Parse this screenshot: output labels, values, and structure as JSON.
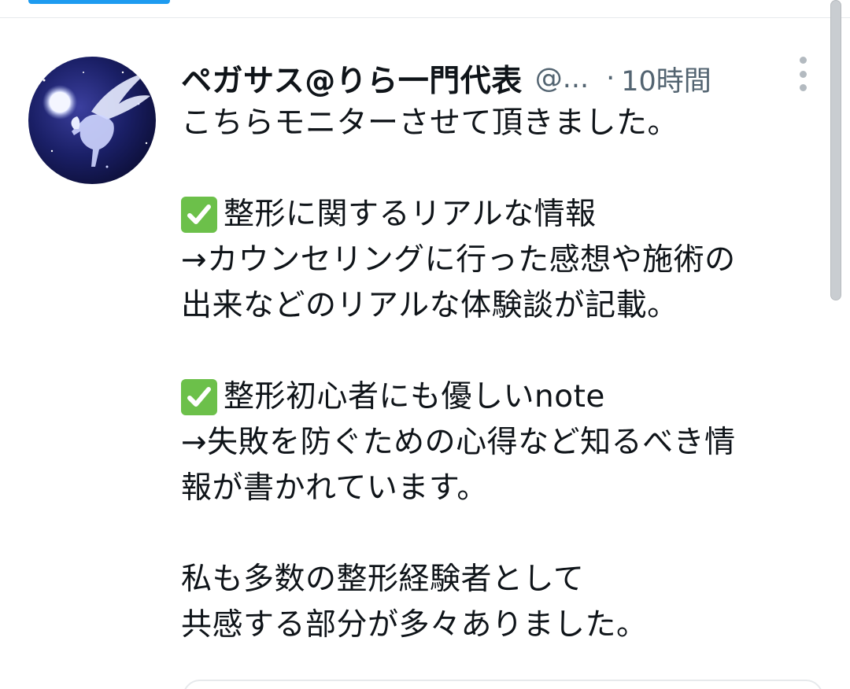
{
  "tweet": {
    "author": {
      "display_name": "ペガサス@りら一門代表",
      "handle": "@...",
      "avatar_icon": "pegasus-avatar"
    },
    "separator": "·",
    "timestamp": "10時間",
    "more_icon": "more-vertical-icon",
    "body": {
      "intro": "こちらモニターさせて頂きました。",
      "point1_title": "整形に関するリアルな情報",
      "point1_line1": "→カウンセリングに行った感想や施術の",
      "point1_line2": "出来などのリアルな体験談が記載。",
      "point2_title": "整形初心者にも優しいnote",
      "point2_line1": "→失敗を防ぐための心得など知るべき情",
      "point2_line2": "報が書かれています。",
      "closing_line1": "私も多数の整形経験者として",
      "closing_line2": "共感する部分が多々ありました。",
      "check_icon": "check-mark-button-icon"
    }
  },
  "colors": {
    "accent": "#1d9bf0",
    "text_primary": "#0f1419",
    "text_secondary": "#536471",
    "check_green": "#6cc04a"
  }
}
